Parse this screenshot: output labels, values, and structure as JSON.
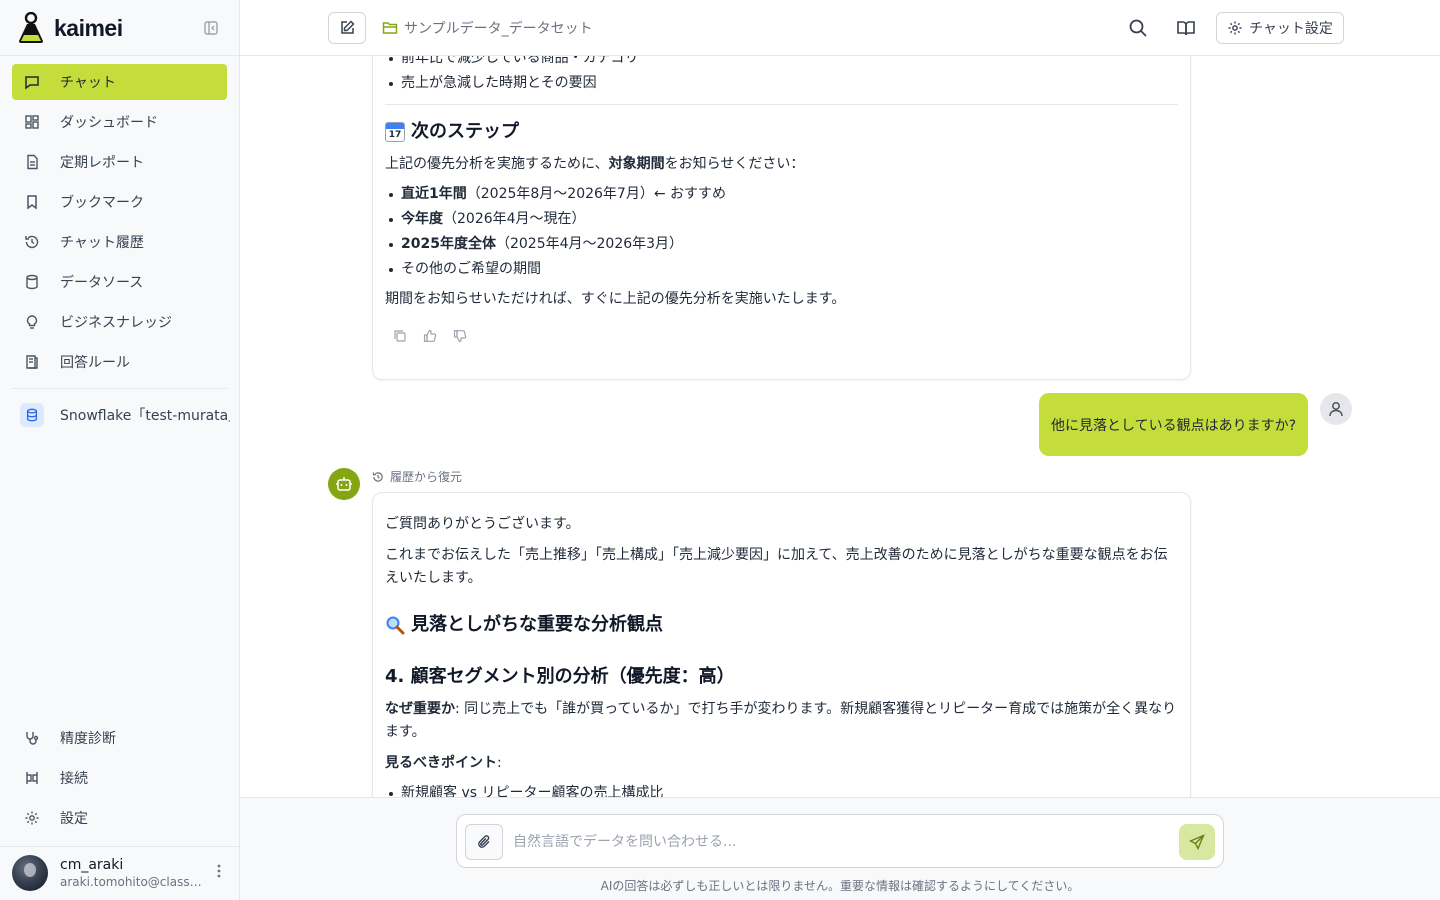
{
  "app": {
    "brand": "kaimei"
  },
  "sidebar": {
    "items": [
      {
        "label": "チャット",
        "icon": "chat-icon",
        "active": true
      },
      {
        "label": "ダッシュボード",
        "icon": "dashboard-icon"
      },
      {
        "label": "定期レポート",
        "icon": "report-icon"
      },
      {
        "label": "ブックマーク",
        "icon": "bookmark-icon"
      },
      {
        "label": "チャット履歴",
        "icon": "history-icon"
      },
      {
        "label": "データソース",
        "icon": "database-icon"
      },
      {
        "label": "ビジネスナレッジ",
        "icon": "lightbulb-icon"
      },
      {
        "label": "回答ルール",
        "icon": "rules-icon"
      }
    ],
    "datasource": "Snowflake「test-murata」",
    "bottom_items": [
      {
        "label": "精度診断",
        "icon": "stethoscope-icon"
      },
      {
        "label": "接続",
        "icon": "connection-icon"
      },
      {
        "label": "設定",
        "icon": "gear-icon"
      }
    ],
    "user": {
      "name": "cm_araki",
      "email": "araki.tomohito@classmethod.jp"
    }
  },
  "header": {
    "dataset": "サンプルデータ_データセット",
    "settings_label": "チャット設定"
  },
  "chat": {
    "card1": {
      "top_items": [
        "前年比で減少している商品・カテゴリ",
        "売上が急減した時期とその要因"
      ],
      "next_heading": "次のステップ",
      "calendar_day": "17",
      "intro_pre": "上記の優先分析を実施するために、",
      "intro_bold": "対象期間",
      "intro_post": "をお知らせください：",
      "options": [
        {
          "bold": "直近1年間",
          "rest": "（2025年8月〜2026年7月）← おすすめ"
        },
        {
          "bold": "今年度",
          "rest": "（2026年4月〜現在）"
        },
        {
          "bold": "2025年度全体",
          "rest": "（2025年4月〜2026年3月）"
        },
        {
          "bold": "",
          "rest": "その他のご希望の期間"
        }
      ],
      "closing": "期間をお知らせいただければ、すぐに上記の優先分析を実施いたします。"
    },
    "user_message": "他に見落としている観点はありますか?",
    "restore_label": "履歴から復元",
    "card2": {
      "greeting": "ご質問ありがとうございます。",
      "intro": "これまでお伝えした「売上推移」「売上構成」「売上減少要因」に加えて、売上改善のために見落としがちな重要な観点をお伝えいたします。",
      "heading": "見落としがちな重要な分析観点",
      "subheading": "4. 顧客セグメント別の分析（優先度：高）",
      "why_label": "なぜ重要か",
      "why_text": ": 同じ売上でも「誰が買っているか」で打ち手が変わります。新規顧客獲得とリピーター育成では施策が全く異なります。",
      "points_label": "見るべきポイント",
      "points_colon": ":",
      "points": [
        "新規顧客 vs リピーター顧客の売上構成比"
      ]
    }
  },
  "composer": {
    "placeholder": "自然言語でデータを問い合わせる...",
    "disclaimer": "AIの回答は必ずしも正しいとは限りません。重要な情報は確認するようにしてください。"
  }
}
